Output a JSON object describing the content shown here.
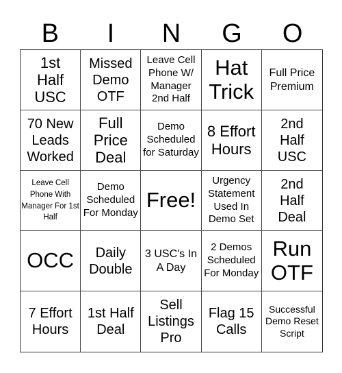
{
  "header": {
    "letters": [
      "B",
      "I",
      "N",
      "G",
      "O"
    ]
  },
  "cells": [
    [
      "1st Half USC",
      "Missed Demo OTF",
      "Leave Cell Phone W/ Manager 2nd Half",
      "Hat Trick",
      "Full Price Premium"
    ],
    [
      "70 New Leads Worked",
      "Full Price Deal",
      "Demo Scheduled for Saturday",
      "8 Effort Hours",
      "2nd Half USC"
    ],
    [
      "Leave Cell Phone With Manager For 1st Half",
      "Demo Scheduled For Monday",
      "Free!",
      "Urgency Statement Used In Demo Set",
      "2nd Half Deal"
    ],
    [
      "OCC",
      "Daily Double",
      "3 USC's In A Day",
      "2 Demos Scheduled For Monday",
      "Run OTF"
    ],
    [
      "7 Effort Hours",
      "1st Half Deal",
      "Sell Listings Pro",
      "Flag 15 Calls",
      "Successful Demo Reset Script"
    ]
  ]
}
